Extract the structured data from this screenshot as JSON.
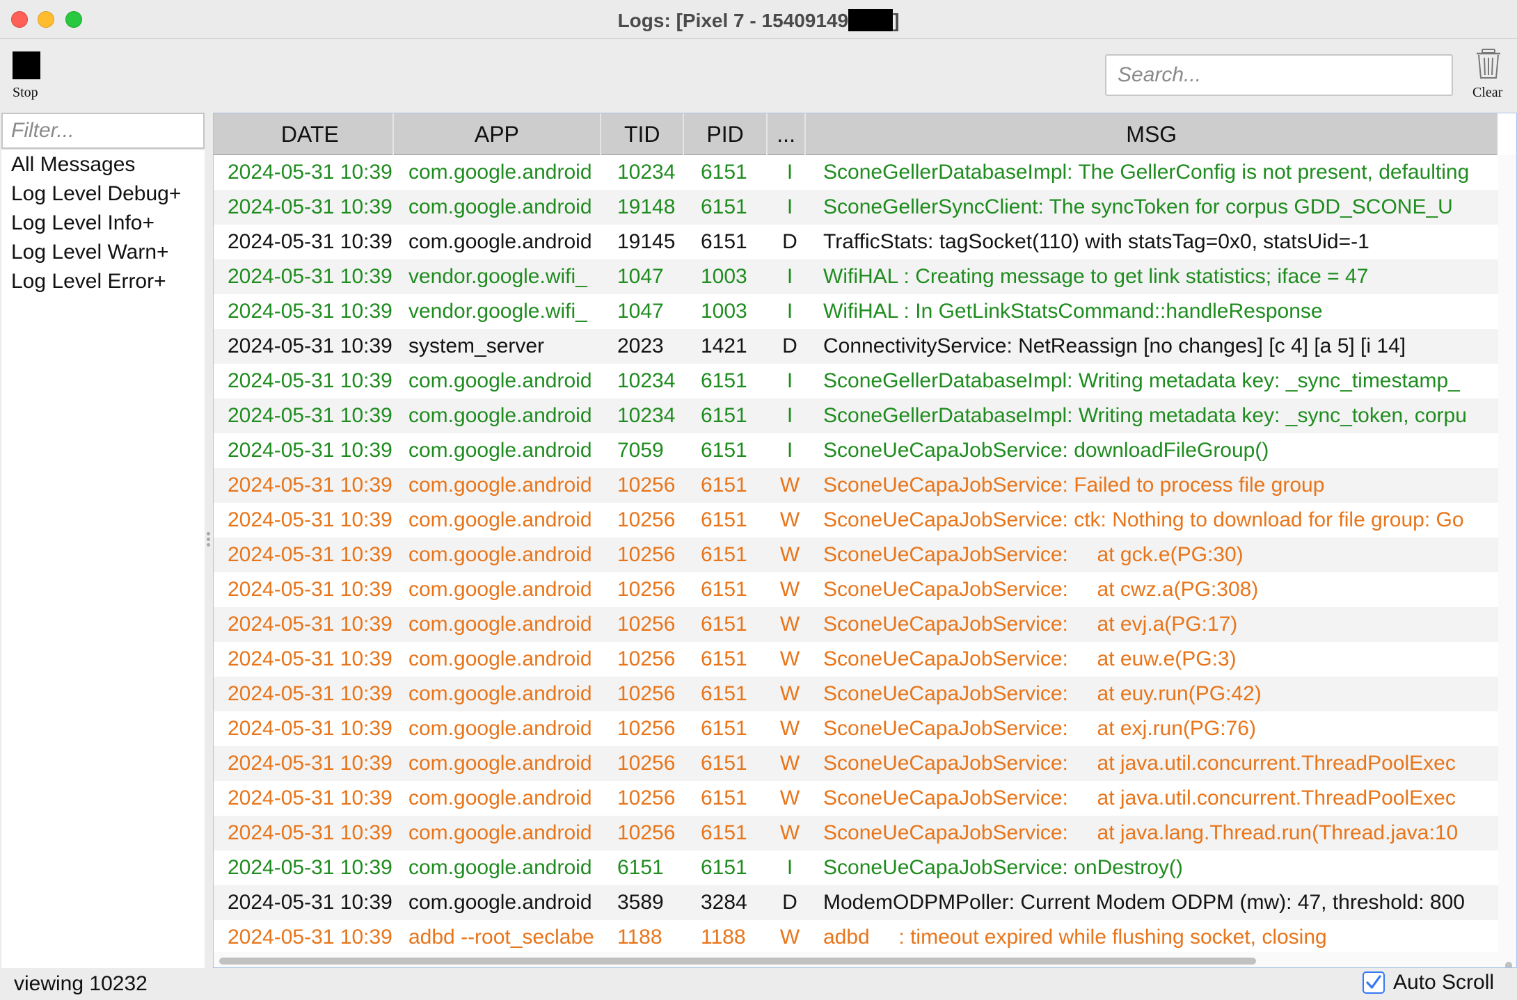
{
  "window": {
    "title": "Logs: [Pixel 7 - 15409149",
    "title_tail": "]"
  },
  "toolbar": {
    "stop_label": "Stop",
    "stop_icon": "stop-square-icon",
    "search_placeholder": "Search...",
    "clear_label": "Clear",
    "clear_icon": "trash-icon"
  },
  "sidebar": {
    "filter_placeholder": "Filter...",
    "items": [
      "All Messages",
      "Log Level Debug+",
      "Log Level Info+",
      "Log Level Warn+",
      "Log Level Error+"
    ]
  },
  "table": {
    "columns": [
      "DATE",
      "APP",
      "TID",
      "PID",
      "...",
      "MSG"
    ],
    "rows": [
      {
        "date": "2024-05-31 10:39",
        "app": "com.google.android",
        "tid": "10234",
        "pid": "6151",
        "level": "I",
        "msg": "SconeGellerDatabaseImpl: The GellerConfig is not present, defaulting"
      },
      {
        "date": "2024-05-31 10:39",
        "app": "com.google.android",
        "tid": "19148",
        "pid": "6151",
        "level": "I",
        "msg": "SconeGellerSyncClient: The syncToken for corpus GDD_SCONE_U"
      },
      {
        "date": "2024-05-31 10:39",
        "app": "com.google.android",
        "tid": "19145",
        "pid": "6151",
        "level": "D",
        "msg": "TrafficStats: tagSocket(110) with statsTag=0x0, statsUid=-1"
      },
      {
        "date": "2024-05-31 10:39",
        "app": "vendor.google.wifi_",
        "tid": "1047",
        "pid": "1003",
        "level": "I",
        "msg": "WifiHAL : Creating message to get link statistics; iface = 47"
      },
      {
        "date": "2024-05-31 10:39",
        "app": "vendor.google.wifi_",
        "tid": "1047",
        "pid": "1003",
        "level": "I",
        "msg": "WifiHAL : In GetLinkStatsCommand::handleResponse"
      },
      {
        "date": "2024-05-31 10:39",
        "app": "system_server",
        "tid": "2023",
        "pid": "1421",
        "level": "D",
        "msg": "ConnectivityService: NetReassign [no changes] [c 4] [a 5] [i 14]"
      },
      {
        "date": "2024-05-31 10:39",
        "app": "com.google.android",
        "tid": "10234",
        "pid": "6151",
        "level": "I",
        "msg": "SconeGellerDatabaseImpl: Writing metadata key: _sync_timestamp_"
      },
      {
        "date": "2024-05-31 10:39",
        "app": "com.google.android",
        "tid": "10234",
        "pid": "6151",
        "level": "I",
        "msg": "SconeGellerDatabaseImpl: Writing metadata key: _sync_token, corpu"
      },
      {
        "date": "2024-05-31 10:39",
        "app": "com.google.android",
        "tid": "7059",
        "pid": "6151",
        "level": "I",
        "msg": "SconeUeCapaJobService: downloadFileGroup()"
      },
      {
        "date": "2024-05-31 10:39",
        "app": "com.google.android",
        "tid": "10256",
        "pid": "6151",
        "level": "W",
        "msg": "SconeUeCapaJobService: Failed to process file group"
      },
      {
        "date": "2024-05-31 10:39",
        "app": "com.google.android",
        "tid": "10256",
        "pid": "6151",
        "level": "W",
        "msg": "SconeUeCapaJobService: ctk: Nothing to download for file group: Go"
      },
      {
        "date": "2024-05-31 10:39",
        "app": "com.google.android",
        "tid": "10256",
        "pid": "6151",
        "level": "W",
        "msg": "SconeUeCapaJobService:     at gck.e(PG:30)"
      },
      {
        "date": "2024-05-31 10:39",
        "app": "com.google.android",
        "tid": "10256",
        "pid": "6151",
        "level": "W",
        "msg": "SconeUeCapaJobService:     at cwz.a(PG:308)"
      },
      {
        "date": "2024-05-31 10:39",
        "app": "com.google.android",
        "tid": "10256",
        "pid": "6151",
        "level": "W",
        "msg": "SconeUeCapaJobService:     at evj.a(PG:17)"
      },
      {
        "date": "2024-05-31 10:39",
        "app": "com.google.android",
        "tid": "10256",
        "pid": "6151",
        "level": "W",
        "msg": "SconeUeCapaJobService:     at euw.e(PG:3)"
      },
      {
        "date": "2024-05-31 10:39",
        "app": "com.google.android",
        "tid": "10256",
        "pid": "6151",
        "level": "W",
        "msg": "SconeUeCapaJobService:     at euy.run(PG:42)"
      },
      {
        "date": "2024-05-31 10:39",
        "app": "com.google.android",
        "tid": "10256",
        "pid": "6151",
        "level": "W",
        "msg": "SconeUeCapaJobService:     at exj.run(PG:76)"
      },
      {
        "date": "2024-05-31 10:39",
        "app": "com.google.android",
        "tid": "10256",
        "pid": "6151",
        "level": "W",
        "msg": "SconeUeCapaJobService:     at java.util.concurrent.ThreadPoolExec"
      },
      {
        "date": "2024-05-31 10:39",
        "app": "com.google.android",
        "tid": "10256",
        "pid": "6151",
        "level": "W",
        "msg": "SconeUeCapaJobService:     at java.util.concurrent.ThreadPoolExec"
      },
      {
        "date": "2024-05-31 10:39",
        "app": "com.google.android",
        "tid": "10256",
        "pid": "6151",
        "level": "W",
        "msg": "SconeUeCapaJobService:     at java.lang.Thread.run(Thread.java:10"
      },
      {
        "date": "2024-05-31 10:39",
        "app": "com.google.android",
        "tid": "6151",
        "pid": "6151",
        "level": "I",
        "msg": "SconeUeCapaJobService: onDestroy()"
      },
      {
        "date": "2024-05-31 10:39",
        "app": "com.google.android",
        "tid": "3589",
        "pid": "3284",
        "level": "D",
        "msg": "ModemODPMPoller: Current Modem ODPM (mw): 47, threshold: 800"
      },
      {
        "date": "2024-05-31 10:39",
        "app": "adbd --root_seclabe",
        "tid": "1188",
        "pid": "1188",
        "level": "W",
        "msg": "adbd     : timeout expired while flushing socket, closing"
      }
    ]
  },
  "status": {
    "viewing": "viewing 10232",
    "auto_scroll_label": "Auto Scroll",
    "auto_scroll_checked": true
  },
  "colors": {
    "info": "#1f8c1f",
    "debug": "#141414",
    "warn": "#e8751a",
    "accent": "#3478f6"
  }
}
